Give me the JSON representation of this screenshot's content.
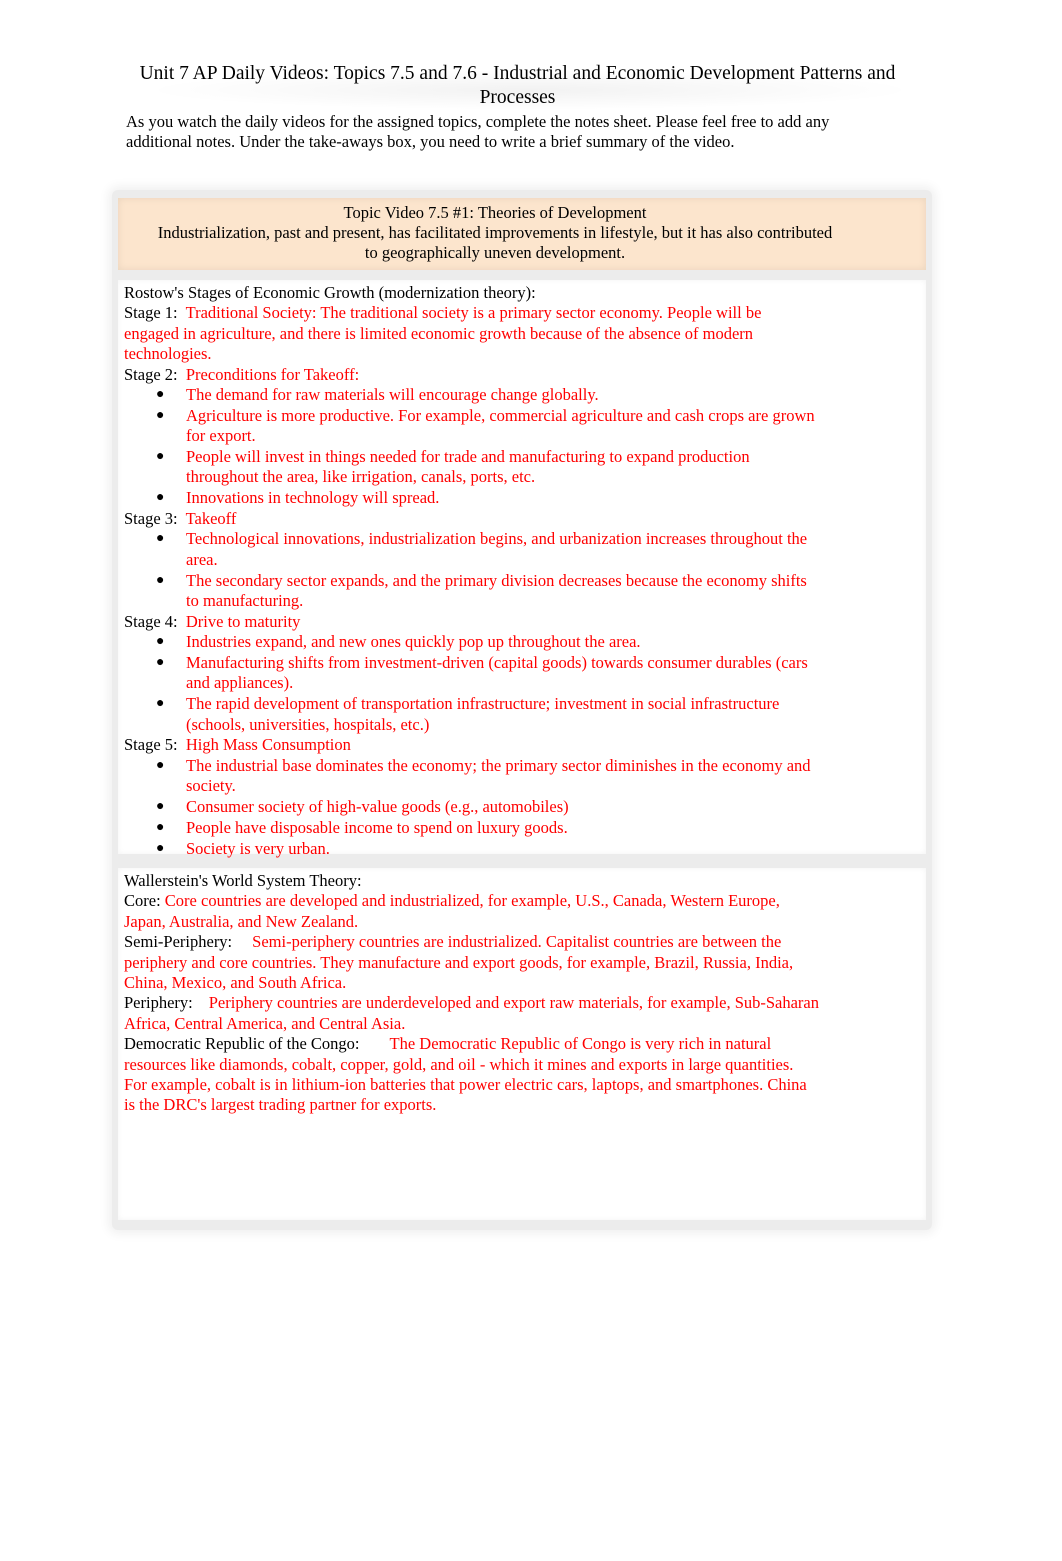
{
  "document": {
    "title": "Unit 7 AP Daily Videos: Topics 7.5 and 7.6 - Industrial and Economic Development Patterns and Processes",
    "intro": "As you watch the daily videos for the assigned topics, complete the notes sheet. Please feel free to add any additional notes. Under the take-aways box, you need to write a brief summary of the video."
  },
  "header": {
    "topic": "Topic Video 7.5 #1: Theories of Development",
    "description": "Industrialization, past and present, has facilitated improvements in lifestyle, but it has also contributed to geographically uneven development."
  },
  "rostow": {
    "heading": "Rostow's Stages of Economic Growth (modernization theory):",
    "stages": [
      {
        "label": "Stage 1:",
        "title": "Traditional Society: The traditional society is a primary sector economy. People will be engaged in agriculture, and there is limited economic growth because of the absence of modern technologies.",
        "bullets": []
      },
      {
        "label": "Stage 2:",
        "title": "Preconditions for Takeoff:",
        "bullets": [
          "The demand for raw materials will encourage change globally.",
          "Agriculture is more productive. For example, commercial agriculture and cash crops are grown for export.",
          "People will invest in things needed for trade and manufacturing to expand production throughout the area, like irrigation, canals, ports, etc.",
          "Innovations in technology will spread."
        ]
      },
      {
        "label": "Stage 3:",
        "title": "Takeoff",
        "bullets": [
          "Technological innovations, industrialization begins, and urbanization increases throughout the area.",
          "The secondary sector expands, and the primary division decreases because the economy shifts to manufacturing."
        ]
      },
      {
        "label": "Stage 4:",
        "title": "Drive to maturity",
        "bullets": [
          "Industries expand, and new ones quickly pop up throughout the area.",
          "Manufacturing shifts from investment-driven (capital goods) towards consumer durables (cars and appliances).",
          "The rapid development of transportation infrastructure; investment in social infrastructure (schools, universities, hospitals, etc.)"
        ]
      },
      {
        "label": "Stage 5:",
        "title": "High Mass Consumption",
        "bullets": [
          "The industrial base dominates the economy; the primary sector diminishes in the economy and society.",
          "Consumer society of high-value goods (e.g., automobiles)",
          "People have disposable income to spend on luxury goods.",
          "Society is very urban."
        ]
      }
    ]
  },
  "wallerstein": {
    "heading": "Wallerstein's World System Theory:",
    "entries": [
      {
        "label": "Core:",
        "text": "Core countries are developed and industrialized, for example, U.S., Canada, Western Europe, Japan, Australia, and New Zealand."
      },
      {
        "label": "Semi-Periphery:",
        "text": "Semi-periphery countries are industrialized. Capitalist countries are between the periphery and core countries. They manufacture and export goods, for example, Brazil, Russia, India, China, Mexico, and South Africa."
      },
      {
        "label": "Periphery:",
        "text": "Periphery countries are underdeveloped and export raw materials, for example, Sub-Saharan Africa, Central America, and Central Asia."
      },
      {
        "label": "Democratic Republic of the Congo:",
        "text": "The Democratic Republic of Congo is very rich in natural resources like diamonds, cobalt, copper, gold, and oil - which it mines and exports in large quantities. For example, cobalt is in lithium-ion batteries that power electric cars, laptops, and smartphones. China is the DRC's largest trading partner for exports."
      }
    ]
  },
  "bullet_glyph": "●",
  "colors": {
    "answer_text": "#ff0000",
    "header_fill": "#fce5cd"
  }
}
